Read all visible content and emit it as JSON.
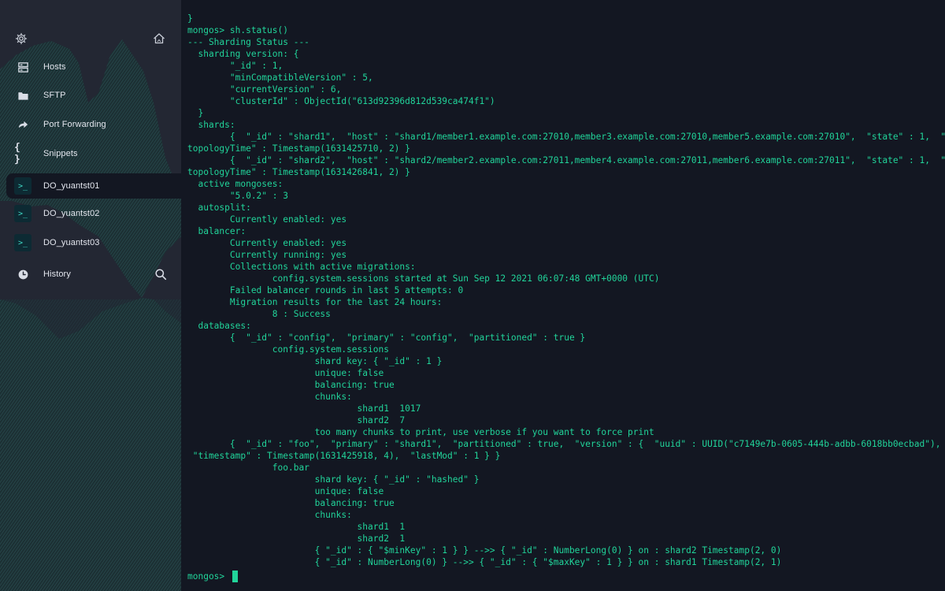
{
  "colors": {
    "sidebar_bg": "#232733",
    "terminal_bg": "#131722",
    "terminal_text": "#21d49a",
    "accent_teal": "#3fd7c4"
  },
  "sidebar": {
    "top_icons": {
      "left": "gear-icon",
      "right": "home-icon"
    },
    "items": [
      {
        "label": "Hosts",
        "icon": "hosts-icon"
      },
      {
        "label": "SFTP",
        "icon": "folder-icon"
      },
      {
        "label": "Port Forwarding",
        "icon": "forward-arrow-icon"
      },
      {
        "label": "Snippets",
        "icon": "braces-icon",
        "glyph": "{ }"
      },
      {
        "label": "DO_yuantst01",
        "icon": "terminal-icon",
        "glyph": ">_",
        "active": true
      },
      {
        "label": "DO_yuantst02",
        "icon": "terminal-icon",
        "glyph": ">_"
      },
      {
        "label": "DO_yuantst03",
        "icon": "terminal-icon",
        "glyph": ">_"
      },
      {
        "label": "History",
        "icon": "clock-icon"
      }
    ],
    "history_search_icon": "search-icon"
  },
  "terminal": {
    "lines": [
      "}",
      "mongos> sh.status()",
      "--- Sharding Status ---",
      "  sharding version: {",
      "        \"_id\" : 1,",
      "        \"minCompatibleVersion\" : 5,",
      "        \"currentVersion\" : 6,",
      "        \"clusterId\" : ObjectId(\"613d92396d812d539ca474f1\")",
      "  }",
      "  shards:",
      "        {  \"_id\" : \"shard1\",  \"host\" : \"shard1/member1.example.com:27010,member3.example.com:27010,member5.example.com:27010\",  \"state\" : 1,  \"",
      "topologyTime\" : Timestamp(1631425710, 2) }",
      "        {  \"_id\" : \"shard2\",  \"host\" : \"shard2/member2.example.com:27011,member4.example.com:27011,member6.example.com:27011\",  \"state\" : 1,  \"",
      "topologyTime\" : Timestamp(1631426841, 2) }",
      "  active mongoses:",
      "        \"5.0.2\" : 3",
      "  autosplit:",
      "        Currently enabled: yes",
      "  balancer:",
      "        Currently enabled: yes",
      "        Currently running: yes",
      "        Collections with active migrations:",
      "                config.system.sessions started at Sun Sep 12 2021 06:07:48 GMT+0000 (UTC)",
      "        Failed balancer rounds in last 5 attempts: 0",
      "        Migration results for the last 24 hours:",
      "                8 : Success",
      "  databases:",
      "        {  \"_id\" : \"config\",  \"primary\" : \"config\",  \"partitioned\" : true }",
      "                config.system.sessions",
      "                        shard key: { \"_id\" : 1 }",
      "                        unique: false",
      "                        balancing: true",
      "                        chunks:",
      "                                shard1  1017",
      "                                shard2  7",
      "                        too many chunks to print, use verbose if you want to force print",
      "        {  \"_id\" : \"foo\",  \"primary\" : \"shard1\",  \"partitioned\" : true,  \"version\" : {  \"uuid\" : UUID(\"c7149e7b-0605-444b-adbb-6018bb0ecbad\"),",
      " \"timestamp\" : Timestamp(1631425918, 4),  \"lastMod\" : 1 } }",
      "                foo.bar",
      "                        shard key: { \"_id\" : \"hashed\" }",
      "                        unique: false",
      "                        balancing: true",
      "                        chunks:",
      "                                shard1  1",
      "                                shard2  1",
      "                        { \"_id\" : { \"$minKey\" : 1 } } -->> { \"_id\" : NumberLong(0) } on : shard2 Timestamp(2, 0)",
      "                        { \"_id\" : NumberLong(0) } -->> { \"_id\" : { \"$maxKey\" : 1 } } on : shard1 Timestamp(2, 1)"
    ],
    "prompt": "mongos> "
  }
}
